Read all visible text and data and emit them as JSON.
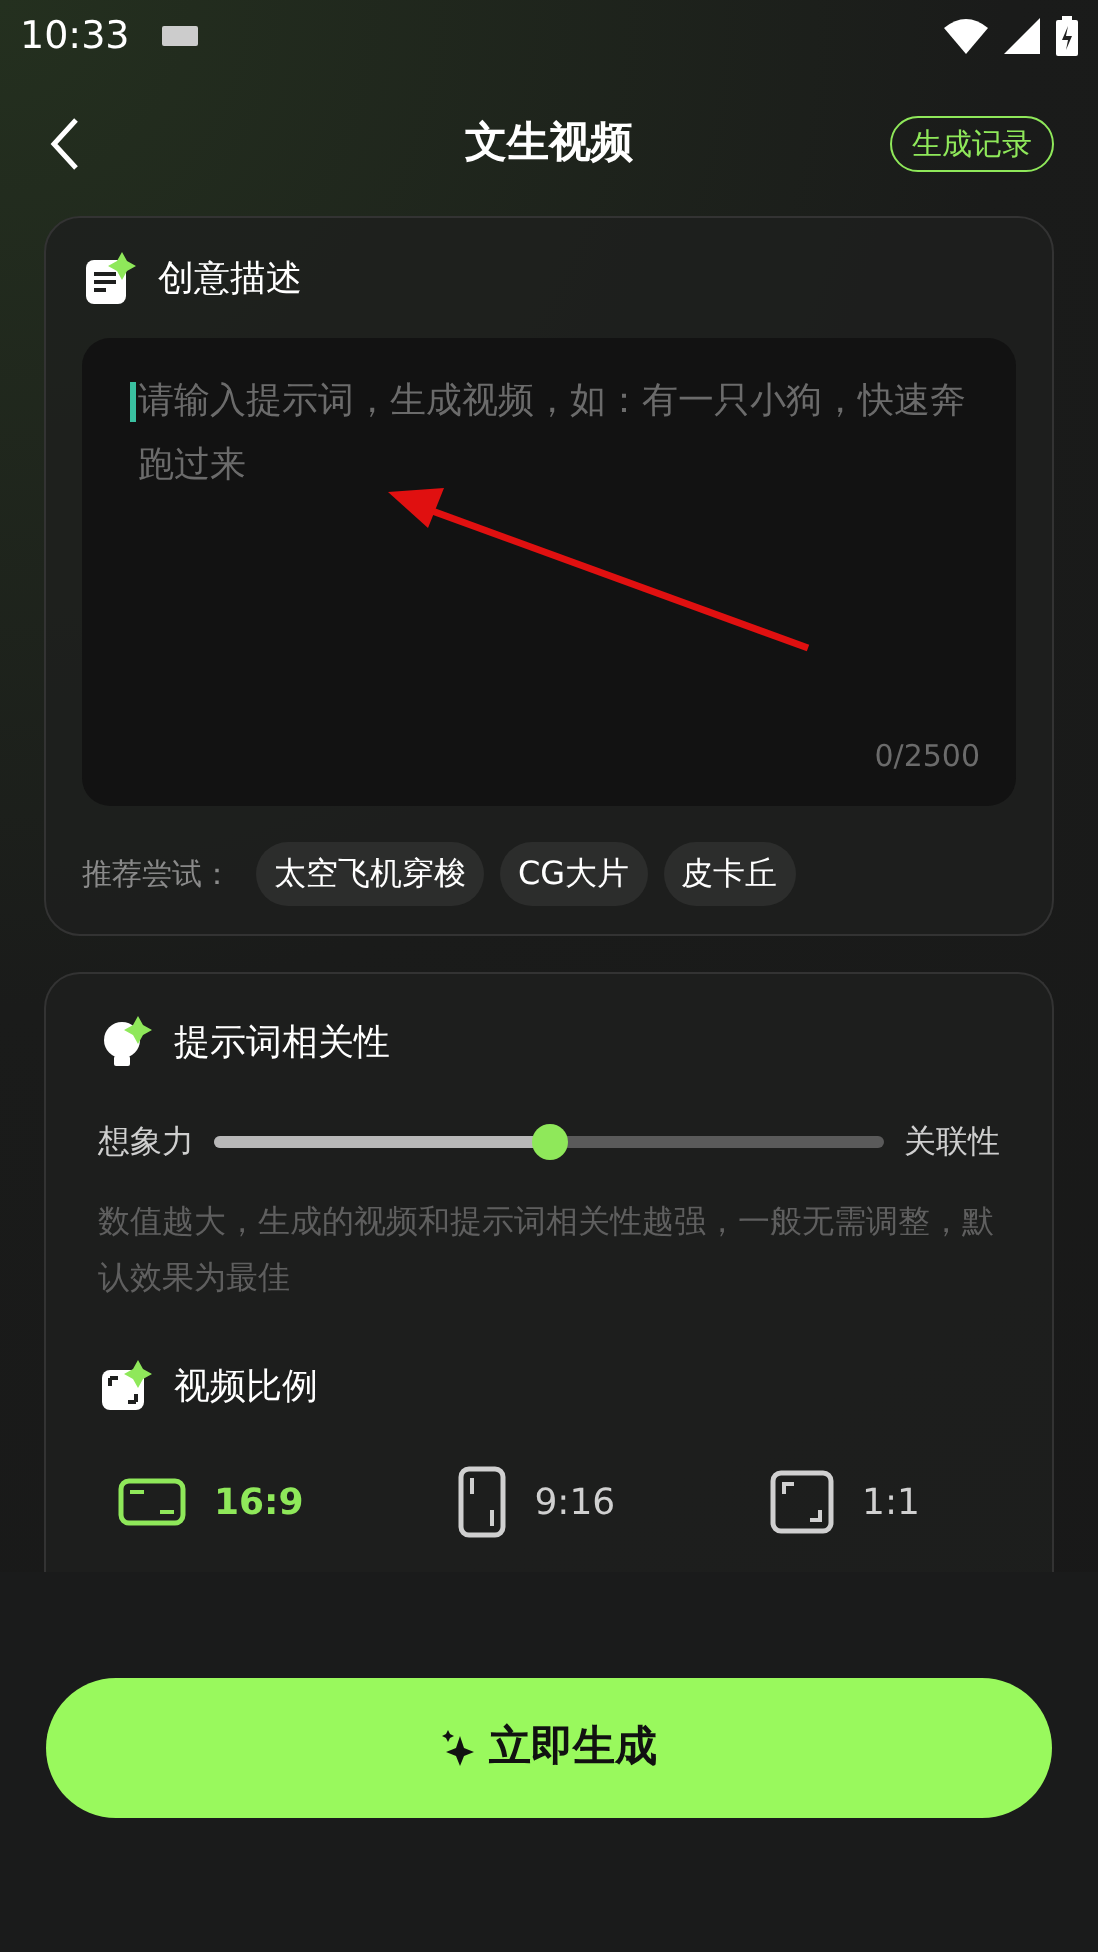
{
  "status_bar": {
    "time": "10:33"
  },
  "header": {
    "title": "文生视频",
    "history_button": "生成记录"
  },
  "description": {
    "title": "创意描述",
    "placeholder": "请输入提示词，生成视频，如：有一只小狗，快速奔跑过来",
    "counter": "0/2500",
    "suggest_label": "推荐尝试：",
    "suggestions": [
      "太空飞机穿梭",
      "CG大片",
      "皮卡丘"
    ]
  },
  "relevance": {
    "title": "提示词相关性",
    "left_label": "想象力",
    "right_label": "关联性",
    "level": 0.5,
    "hint": "数值越大，生成的视频和提示词相关性越强，一般无需调整，默认效果为最佳"
  },
  "ratio": {
    "title": "视频比例",
    "options": [
      {
        "kind": "landscape",
        "label": "16:9",
        "selected": true
      },
      {
        "kind": "portrait",
        "label": "9:16",
        "selected": false
      },
      {
        "kind": "square",
        "label": "1:1",
        "selected": false
      }
    ]
  },
  "generate_button": "立即生成"
}
